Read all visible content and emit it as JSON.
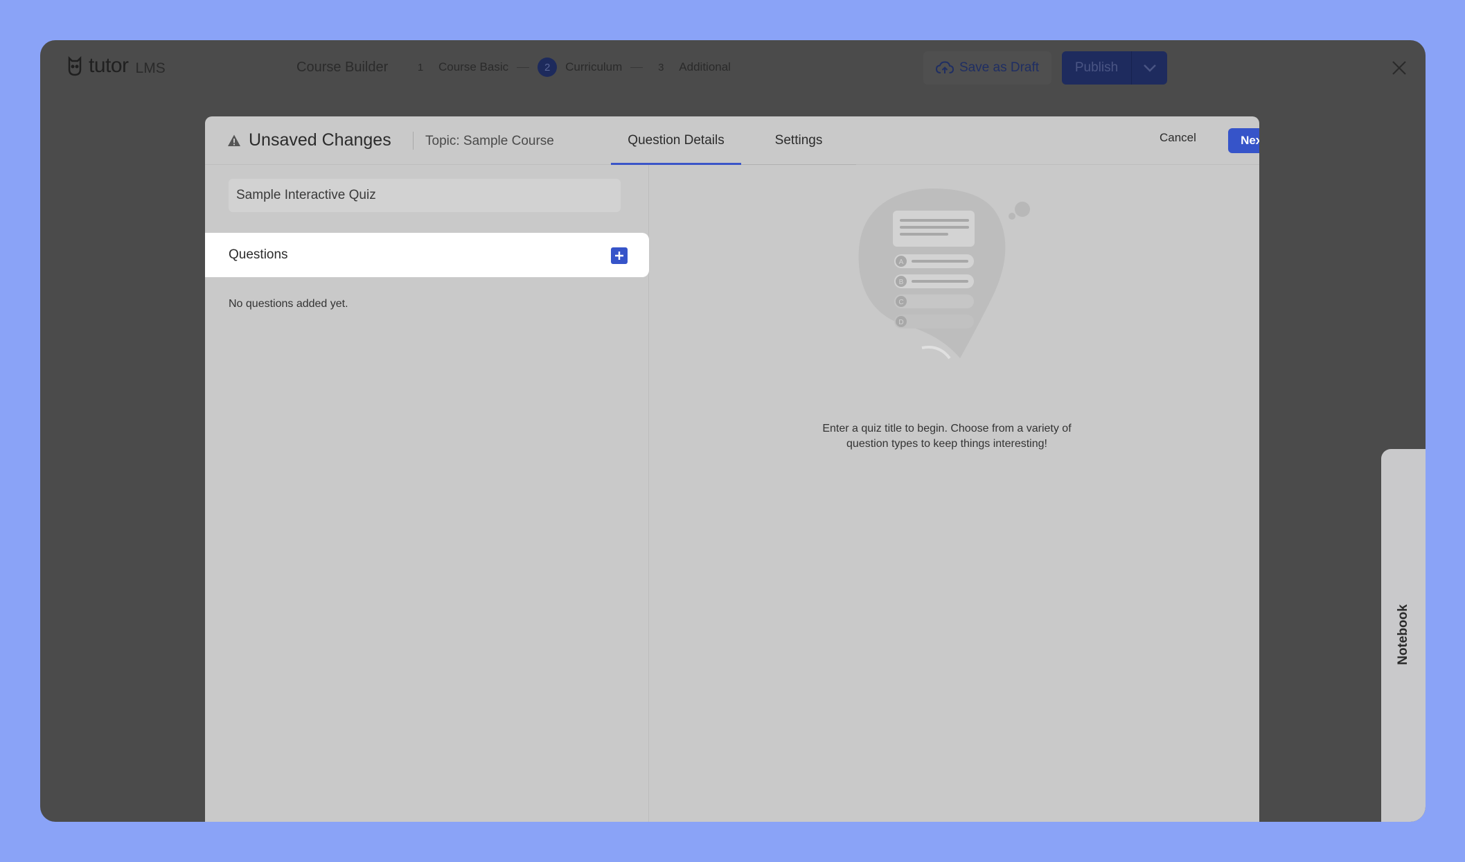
{
  "app": {
    "brand": "tutor",
    "brand_suffix": "LMS",
    "builder_title": "Course Builder"
  },
  "steps": [
    {
      "num": "1",
      "label": "Course Basic"
    },
    {
      "num": "2",
      "label": "Curriculum"
    },
    {
      "num": "3",
      "label": "Additional"
    }
  ],
  "actions": {
    "save_draft": "Save as Draft",
    "publish": "Publish"
  },
  "notebook": {
    "label": "Notebook"
  },
  "modal": {
    "status": "Unsaved Changes",
    "topic": "Topic: Sample Course",
    "tabs": [
      {
        "label": "Question Details"
      },
      {
        "label": "Settings"
      }
    ],
    "cancel": "Cancel",
    "next": "Next"
  },
  "left": {
    "quiz_title_value": "Sample Interactive Quiz",
    "questions_label": "Questions",
    "empty_list": "No questions added yet."
  },
  "right": {
    "option_letters": [
      "A",
      "B",
      "C",
      "D"
    ],
    "empty_message": "Enter a quiz title to begin. Choose from a variety of question types to keep things interesting!"
  },
  "colors": {
    "page_background": "#8aa3f7",
    "accent": "#3654c9"
  }
}
